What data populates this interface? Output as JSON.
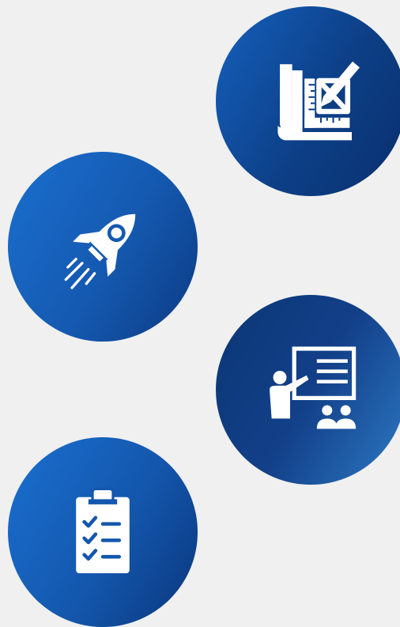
{
  "background_color": "#f0f0f0",
  "icon_color": "#ffffff",
  "badges": [
    {
      "name": "blueprint-icon",
      "gradient": [
        "#1560bd",
        "#0a2f6e"
      ]
    },
    {
      "name": "rocket-icon",
      "gradient": [
        "#1a6fcf",
        "#0c3a82"
      ]
    },
    {
      "name": "presentation-icon",
      "gradient": [
        "#0b3776",
        "#2e79c4"
      ]
    },
    {
      "name": "checklist-icon",
      "gradient": [
        "#1a6fcf",
        "#0b367c"
      ]
    }
  ]
}
